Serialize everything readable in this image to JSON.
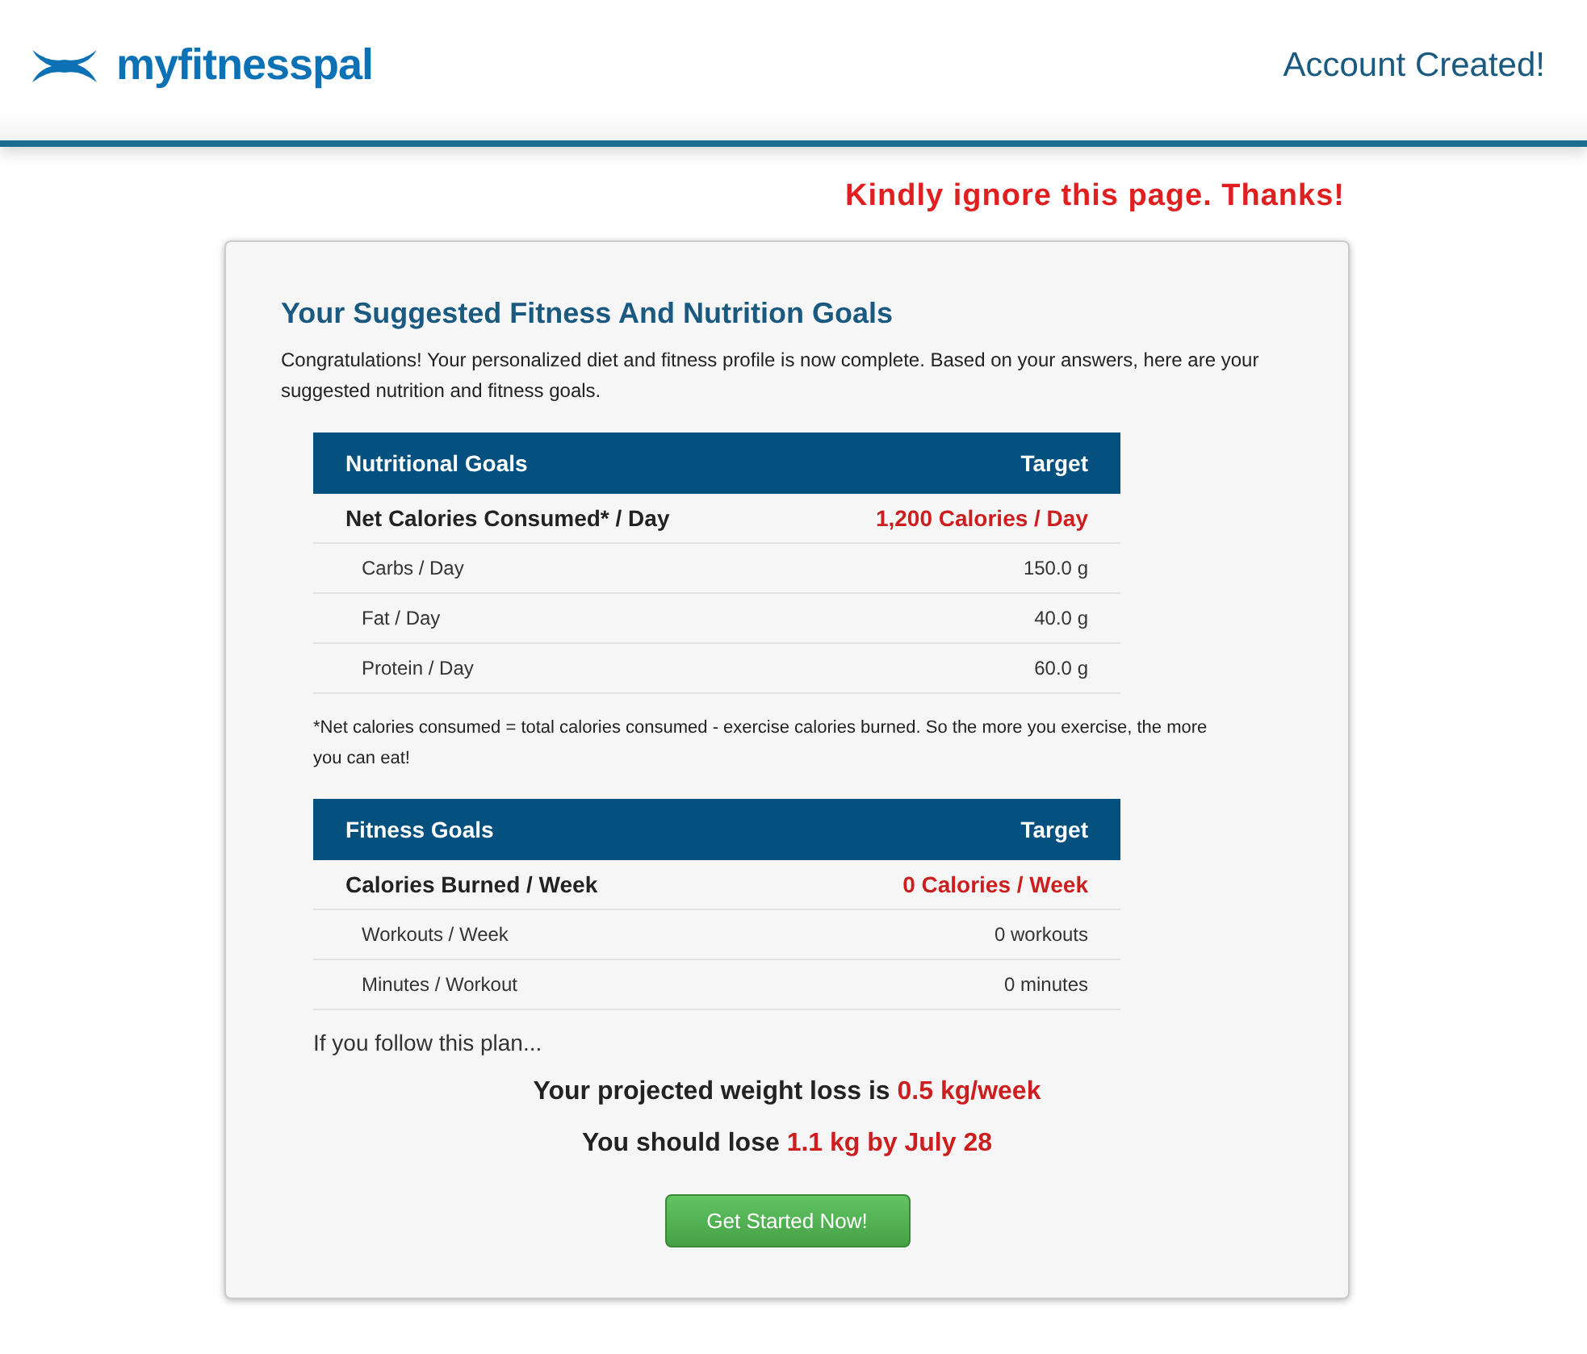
{
  "header": {
    "logo": "myfitnesspal",
    "title": "Account Created!"
  },
  "notice": "Kindly ignore this page. Thanks!",
  "card": {
    "title": "Your Suggested Fitness And Nutrition Goals",
    "intro": "Congratulations! Your personalized diet and fitness profile is now complete. Based on your answers, here are your suggested nutrition and fitness goals.",
    "tables": [
      {
        "columns": [
          "Nutritional Goals",
          "Target"
        ],
        "rows": [
          {
            "kind": "main",
            "label": "Net Calories Consumed* / Day",
            "value": "1,200 Calories / Day"
          },
          {
            "kind": "sub",
            "label": "Carbs / Day",
            "value": "150.0 g"
          },
          {
            "kind": "sub",
            "label": "Fat / Day",
            "value": "40.0 g"
          },
          {
            "kind": "sub",
            "label": "Protein / Day",
            "value": "60.0 g"
          }
        ],
        "footnote": "*Net calories consumed = total calories consumed - exercise calories burned. So the more you exercise, the more you can eat!"
      },
      {
        "columns": [
          "Fitness Goals",
          "Target"
        ],
        "rows": [
          {
            "kind": "main",
            "label": "Calories Burned / Week",
            "value": "0 Calories / Week"
          },
          {
            "kind": "sub",
            "label": "Workouts / Week",
            "value": "0 workouts"
          },
          {
            "kind": "sub",
            "label": "Minutes / Workout",
            "value": "0 minutes"
          }
        ]
      }
    ],
    "plan_intro": "If you follow this plan...",
    "projections": [
      {
        "text": "Your projected weight loss is",
        "value": "0.5 kg/week"
      },
      {
        "text": "You should lose",
        "value": "1.1 kg by July 28"
      }
    ],
    "button": "Get Started Now!"
  }
}
